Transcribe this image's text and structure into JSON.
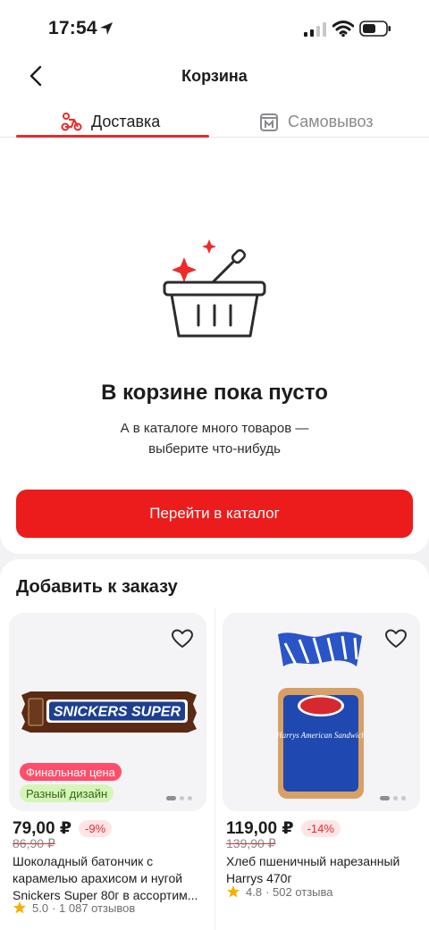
{
  "status_bar": {
    "time": "17:54"
  },
  "header": {
    "title": "Корзина"
  },
  "tabs": [
    {
      "label": "Доставка",
      "active": true,
      "icon": "scooter-icon"
    },
    {
      "label": "Самовывоз",
      "active": false,
      "icon": "store-icon"
    }
  ],
  "empty_state": {
    "title": "В корзине пока пусто",
    "subtitle_line1": "А в каталоге много товаров —",
    "subtitle_line2": "выберите что-нибудь",
    "button_label": "Перейти в каталог"
  },
  "recommendations": {
    "title": "Добавить к заказу",
    "products": [
      {
        "image_text": "SNICKERS SUPER",
        "tags": [
          "Финальная цена",
          "Разный дизайн"
        ],
        "price": "79,00 ₽",
        "discount": "-9%",
        "old_price": "86,90 ₽",
        "name": "Шоколадный батончик с карамелью арахисом и нугой Snickers Super 80г в ассортим...",
        "rating": "5.0",
        "reviews": "· 1 087 отзывов"
      },
      {
        "image_text": "Harrys American Sandwich",
        "tags": [],
        "price": "119,00 ₽",
        "discount": "-14%",
        "old_price": "139,90 ₽",
        "name": "Хлеб пшеничный нарезанный Harrys 470г",
        "rating": "4.8",
        "reviews": "· 502 отзыва"
      }
    ]
  },
  "colors": {
    "accent": "#ec1c1c",
    "tag_final": "#ff4d6a",
    "tag_design": "#d6f5b8",
    "star": "#f5b000"
  }
}
